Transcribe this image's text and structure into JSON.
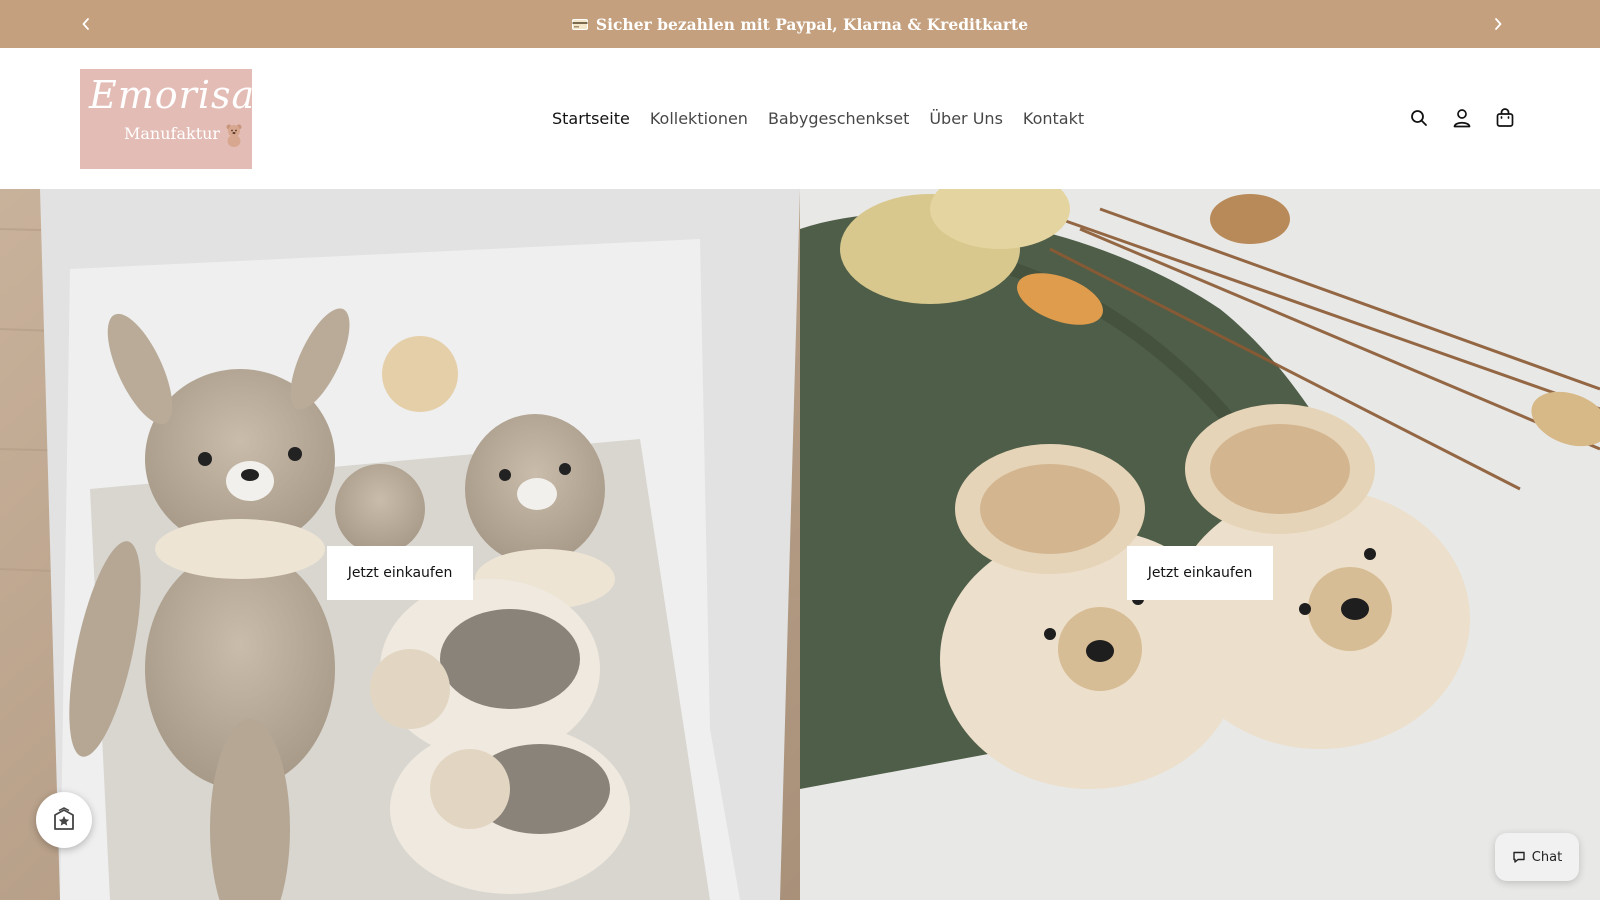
{
  "announcement": {
    "text": "Sicher bezahlen mit Paypal, Klarna & Kreditkarte",
    "icon": "credit-card-icon",
    "background": "#c4a07f",
    "prev_icon": "chevron-left-icon",
    "next_icon": "chevron-right-icon"
  },
  "header": {
    "logo": {
      "script": "Emorisa",
      "subtitle": "Manufaktur",
      "background": "#e3bdb5"
    },
    "nav": [
      {
        "label": "Startseite",
        "active": true
      },
      {
        "label": "Kollektionen",
        "active": false
      },
      {
        "label": "Babygeschenkset",
        "active": false
      },
      {
        "label": "Über Uns",
        "active": false
      },
      {
        "label": "Kontakt",
        "active": false
      }
    ],
    "icons": [
      "search-icon",
      "account-icon",
      "cart-icon"
    ]
  },
  "hero": {
    "panels": [
      {
        "button_label": "Jetzt einkaufen",
        "image": "crochet-deer-gift-box"
      },
      {
        "button_label": "Jetzt einkaufen",
        "image": "crochet-bear-baby-shoes"
      }
    ]
  },
  "widgets": {
    "badge_icon": "shop-badge-icon",
    "chat_label": "Chat",
    "chat_icon": "chat-bubble-icon"
  }
}
